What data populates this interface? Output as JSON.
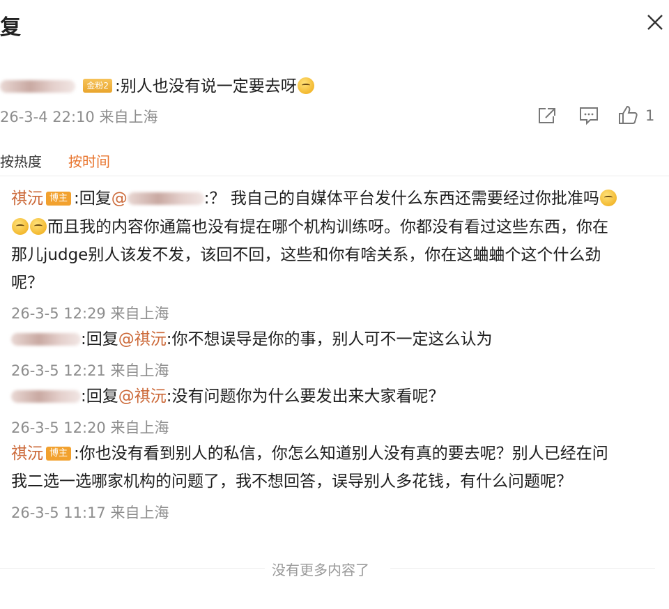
{
  "header": {
    "title": "复"
  },
  "post": {
    "text": ":别人也没有说一定要去呀",
    "badge": "金粉2",
    "time": "26-3-4 22:10 来自上海",
    "like_count": "1"
  },
  "sort_tabs": [
    "按热度",
    "按时间"
  ],
  "replies": [
    {
      "author": "祺沅",
      "badge": "博主",
      "prefix": ":回复",
      "at": "@",
      "line1": ":？ 我自己的自媒体平台发什么东西还需要经过你批准吗",
      "line2": "而且我的内容你通篇也没有提在哪个机构训练呀。你都没有看过这些东西，你在",
      "line3": "那儿judge别人该发不发，该回不回，这些和你有啥关系，你在这蛐蛐个这个什么劲",
      "line4": "呢？",
      "time": "26-3-5 12:29 来自上海"
    },
    {
      "prefix": ":回复",
      "at": "@祺沅",
      "text": ":你不想误导是你的事，别人可不一定这么认为",
      "time": "26-3-5 12:21 来自上海"
    },
    {
      "prefix": ":回复",
      "at": "@祺沅",
      "text": ":没有问题你为什么要发出来大家看呢？",
      "time": "26-3-5 12:20 来自上海"
    },
    {
      "author": "祺沅",
      "badge": "博主",
      "line1": ":你也没有看到别人的私信，你怎么知道别人没有真的要去呢？别人已经在问",
      "line2": "我二选一选哪家机构的问题了，我不想回答，误导别人多花钱，有什么问题呢？",
      "time": "26-3-5 11:17 来自上海"
    }
  ],
  "footer": "没有更多内容了",
  "icons": {
    "close": "close-icon",
    "share": "share-icon",
    "comment": "comment-icon",
    "like": "thumbs-up-icon"
  }
}
